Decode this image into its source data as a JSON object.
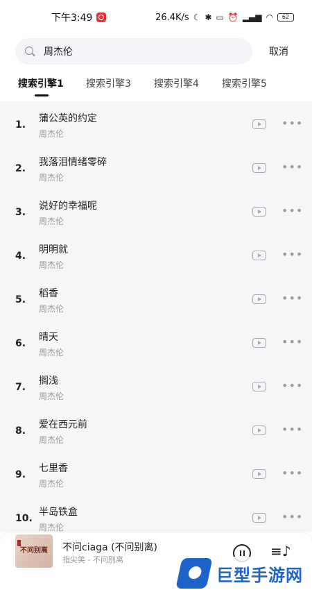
{
  "status_bar": {
    "time": "下午3:49",
    "net_speed": "26.4K/s",
    "battery": "62"
  },
  "search": {
    "query": "周杰伦",
    "placeholder": "",
    "cancel_label": "取消"
  },
  "tabs": [
    {
      "label": "搜索引擎1",
      "active": true
    },
    {
      "label": "搜索引擎3",
      "active": false
    },
    {
      "label": "搜索引擎4",
      "active": false
    },
    {
      "label": "搜索引擎5",
      "active": false
    }
  ],
  "songs": [
    {
      "index": "1.",
      "title": "蒲公英的约定",
      "artist": "周杰伦"
    },
    {
      "index": "2.",
      "title": "我落泪情绪零碎",
      "artist": "周杰伦"
    },
    {
      "index": "3.",
      "title": "说好的幸福呢",
      "artist": "周杰伦"
    },
    {
      "index": "4.",
      "title": "明明就",
      "artist": "周杰伦"
    },
    {
      "index": "5.",
      "title": "稻香",
      "artist": "周杰伦"
    },
    {
      "index": "6.",
      "title": "晴天",
      "artist": "周杰伦"
    },
    {
      "index": "7.",
      "title": "搁浅",
      "artist": "周杰伦"
    },
    {
      "index": "8.",
      "title": "爱在西元前",
      "artist": "周杰伦"
    },
    {
      "index": "9.",
      "title": "七里香",
      "artist": "周杰伦"
    },
    {
      "index": "10.",
      "title": "半岛铁盒",
      "artist": "周杰伦"
    }
  ],
  "player": {
    "title": "不问ciaga (不问别离)",
    "subtitle": "指尖笑 - 不问别离",
    "cover_text": "不问别离"
  },
  "watermark": {
    "text": "巨型手游网"
  },
  "icons": {
    "search": "search-icon",
    "video": "video-icon",
    "more": "more-icon",
    "pause": "pause-icon",
    "playlist": "playlist-icon"
  }
}
